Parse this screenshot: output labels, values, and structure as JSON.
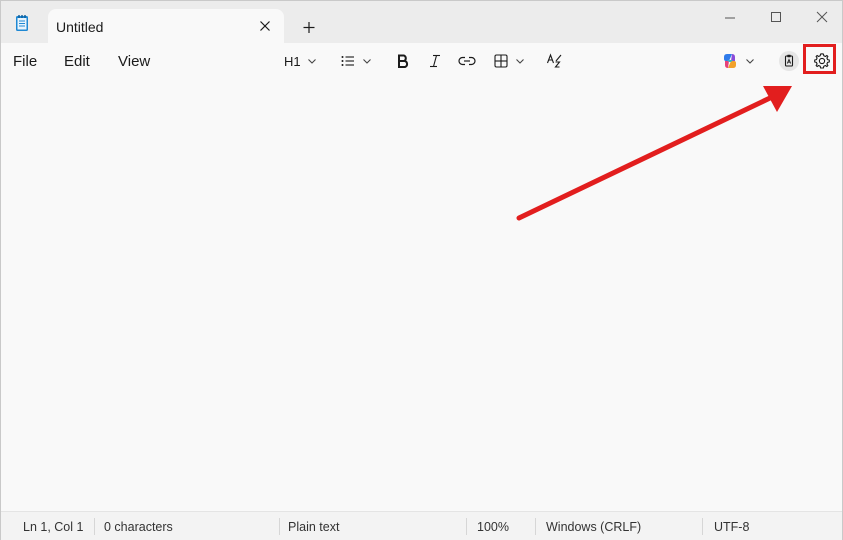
{
  "window": {
    "tab_title": "Untitled",
    "icons": [
      "notepad-icon",
      "close-icon",
      "plus-icon",
      "minimize-icon",
      "maximize-icon",
      "close-window-icon"
    ]
  },
  "menu": {
    "file": "File",
    "edit": "Edit",
    "view": "View"
  },
  "toolbar": {
    "heading_label": "H1",
    "icons": [
      "list-icon",
      "bold-icon",
      "italic-icon",
      "link-icon",
      "table-icon",
      "spellcheck-icon",
      "copilot-icon",
      "clipboard-icon",
      "gear-icon"
    ]
  },
  "status": {
    "position": "Ln 1, Col 1",
    "characters": "0 characters",
    "format": "Plain text",
    "zoom": "100%",
    "line_ending": "Windows (CRLF)",
    "encoding": "UTF-8"
  },
  "annotation": {
    "color": "#e21e1e",
    "target": "settings-button"
  }
}
